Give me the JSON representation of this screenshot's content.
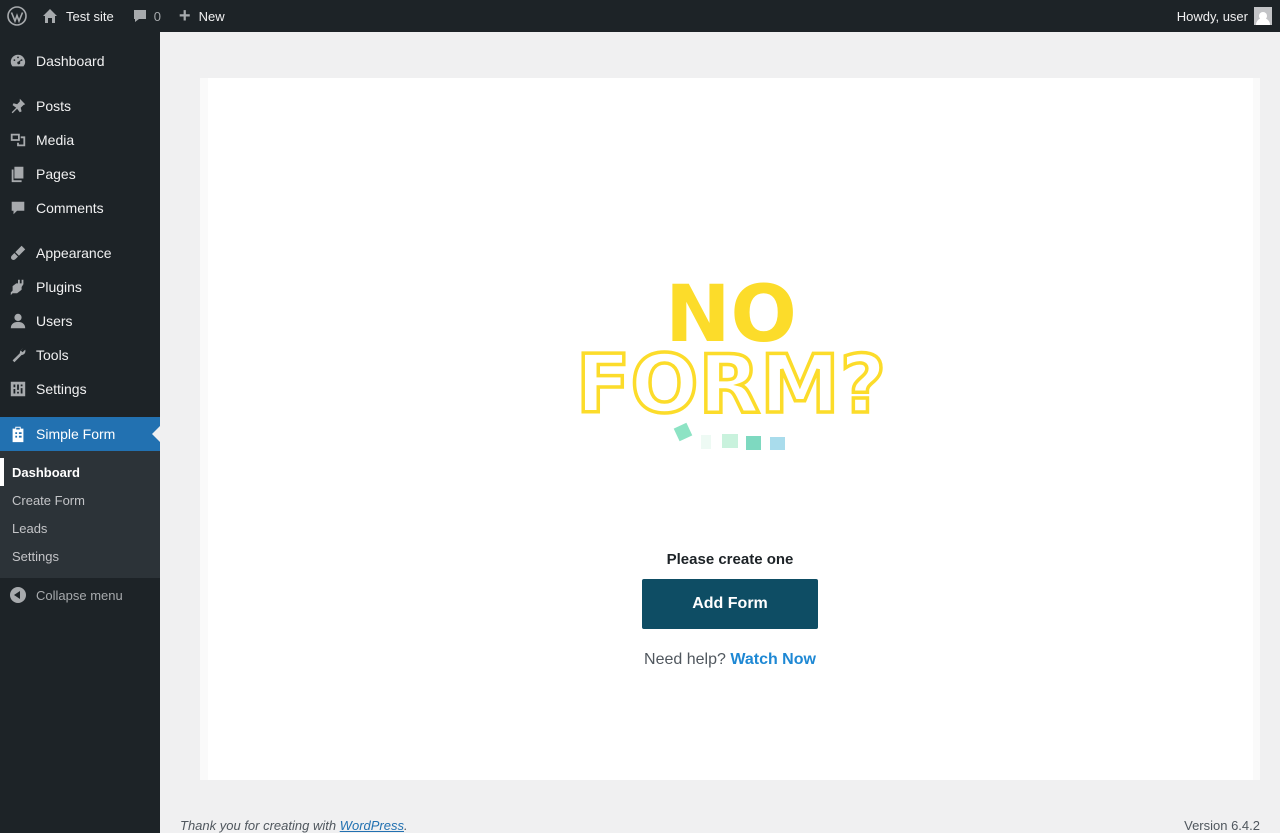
{
  "adminbar": {
    "site_name": "Test site",
    "comments_count": "0",
    "new_label": "New",
    "howdy": "Howdy, user"
  },
  "sidebar": {
    "items": [
      {
        "label": "Dashboard",
        "icon": "dashboard-icon"
      },
      {
        "label": "Posts",
        "icon": "pin-icon"
      },
      {
        "label": "Media",
        "icon": "media-icon"
      },
      {
        "label": "Pages",
        "icon": "pages-icon"
      },
      {
        "label": "Comments",
        "icon": "comment-icon"
      },
      {
        "label": "Appearance",
        "icon": "brush-icon"
      },
      {
        "label": "Plugins",
        "icon": "plugin-icon"
      },
      {
        "label": "Users",
        "icon": "user-icon"
      },
      {
        "label": "Tools",
        "icon": "wrench-icon"
      },
      {
        "label": "Settings",
        "icon": "settings-icon"
      },
      {
        "label": "Simple Form",
        "icon": "clipboard-icon"
      }
    ],
    "submenu": [
      "Dashboard",
      "Create Form",
      "Leads",
      "Settings"
    ],
    "collapse_label": "Collapse menu"
  },
  "main": {
    "illustration": {
      "line1": "NO",
      "line2": "FORM?"
    },
    "prompt": "Please create one",
    "add_form_label": "Add Form",
    "help_text": "Need help?",
    "help_link": "Watch Now"
  },
  "footer": {
    "thanks_prefix": "Thank you for creating with",
    "wp_link": "WordPress",
    "thanks_suffix": ".",
    "version": "Version 6.4.2"
  },
  "colors": {
    "accent": "#2271b1",
    "button": "#0e4d64",
    "illustration_yellow": "#fcdc2a",
    "link": "#1e88d4"
  }
}
